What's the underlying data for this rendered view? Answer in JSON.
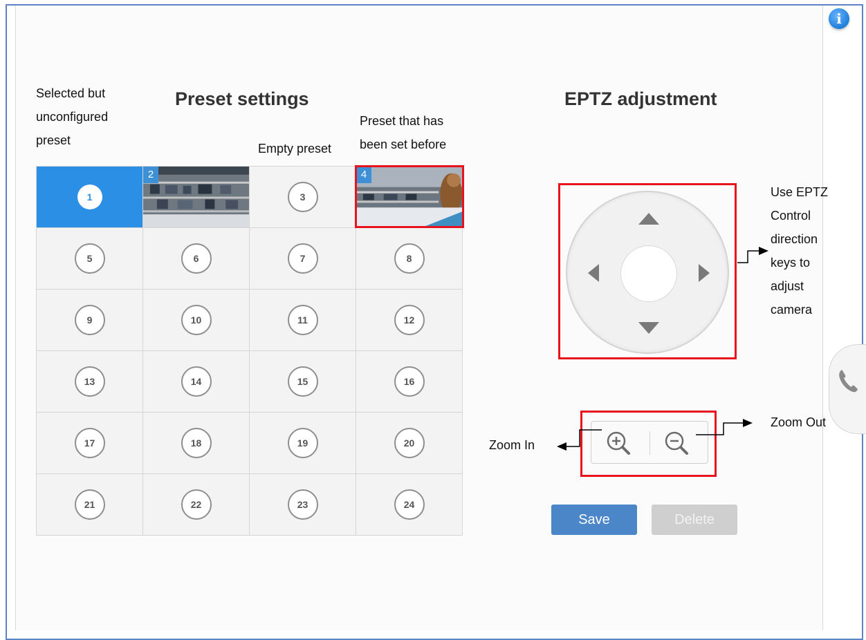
{
  "headings": {
    "preset": "Preset settings",
    "eptz": "EPTZ adjustment"
  },
  "annotations": {
    "selected": [
      "Selected but",
      "unconfigured",
      "preset"
    ],
    "empty": "Empty preset",
    "set_before": [
      "Preset that has",
      "been set before"
    ],
    "eptz_control": [
      "Use EPTZ",
      "Control",
      "direction",
      "keys to",
      "adjust",
      "camera"
    ],
    "zoom_in": "Zoom In",
    "zoom_out": "Zoom Out"
  },
  "presets": [
    "1",
    "2",
    "3",
    "4",
    "5",
    "6",
    "7",
    "8",
    "9",
    "10",
    "11",
    "12",
    "13",
    "14",
    "15",
    "16",
    "17",
    "18",
    "19",
    "20",
    "21",
    "22",
    "23",
    "24"
  ],
  "buttons": {
    "save": "Save",
    "delete": "Delete"
  },
  "icons": {
    "info": "info-icon",
    "phone": "phone-icon",
    "zoom_in": "zoom-in-icon",
    "zoom_out": "zoom-out-icon"
  },
  "colors": {
    "selected": "#2c8fe6",
    "highlight": "#e8131d",
    "save": "#4a86c8",
    "delete_disabled": "#cfcfcf"
  }
}
